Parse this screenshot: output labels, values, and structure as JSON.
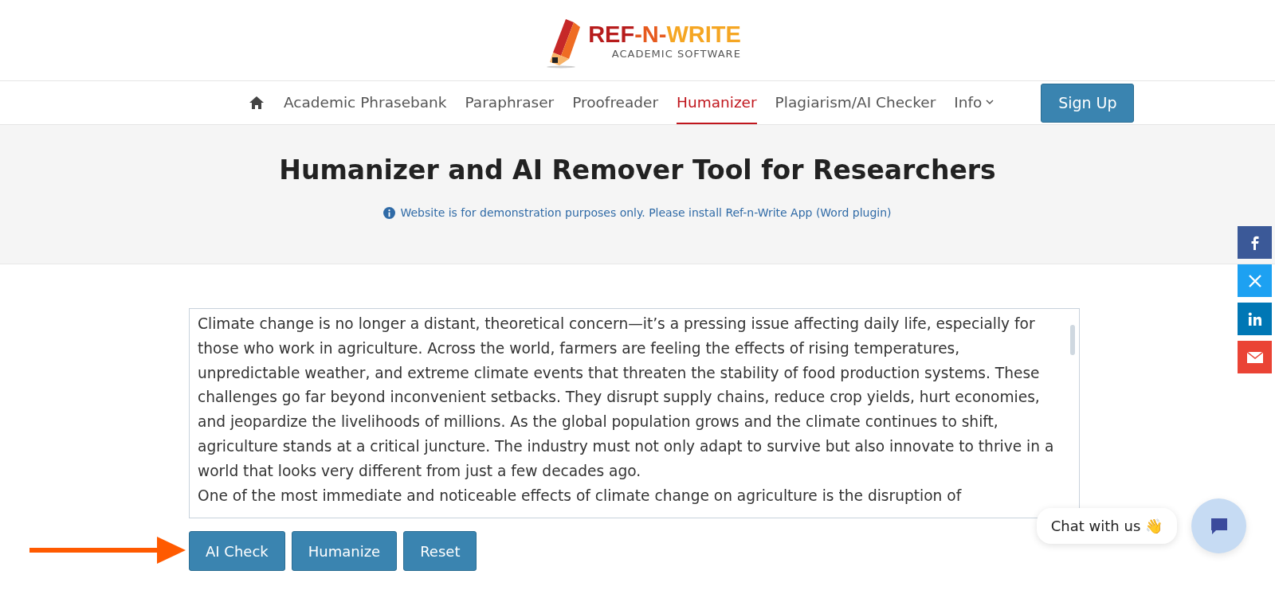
{
  "logo": {
    "brand_parts": [
      "REF",
      "-N-",
      "WRITE"
    ],
    "tagline": "ACADEMIC SOFTWARE"
  },
  "nav": {
    "items": [
      {
        "label": "Academic Phrasebank",
        "selected": false
      },
      {
        "label": "Paraphraser",
        "selected": false
      },
      {
        "label": "Proofreader",
        "selected": false
      },
      {
        "label": "Humanizer",
        "selected": true
      },
      {
        "label": "Plagiarism/AI Checker",
        "selected": false
      },
      {
        "label": "Info",
        "selected": false,
        "kind": "dropdown"
      }
    ],
    "signup": "Sign Up"
  },
  "hero": {
    "title": "Humanizer and AI Remover Tool for Researchers",
    "notice": "Website is for demonstration purposes only. Please install Ref-n-Write App (Word plugin)"
  },
  "editor": {
    "paragraphs": [
      "Climate change is no longer a distant, theoretical concern—it’s a pressing issue affecting daily life, especially for those who work in agriculture. Across the world, farmers are feeling the effects of rising temperatures, unpredictable weather, and extreme climate events that threaten the stability of food production systems. These challenges go far beyond inconvenient setbacks. They disrupt supply chains, reduce crop yields, hurt economies, and jeopardize the livelihoods of millions. As the global population grows and the climate continues to shift, agriculture stands at a critical juncture. The industry must not only adapt to survive but also innovate to thrive in a world that looks very different from just a few decades ago.",
      "One of the most immediate and noticeable effects of climate change on agriculture is the disruption of"
    ]
  },
  "buttons": [
    "AI Check",
    "Humanize",
    "Reset"
  ],
  "social": [
    {
      "kind": "facebook",
      "color": "#3b5998"
    },
    {
      "kind": "x",
      "color": "#1da1f2"
    },
    {
      "kind": "linkedin",
      "color": "#0077b5"
    },
    {
      "kind": "email",
      "color": "#ea4335"
    }
  ],
  "chat": {
    "label": "Chat with us",
    "emoji": "👋"
  }
}
